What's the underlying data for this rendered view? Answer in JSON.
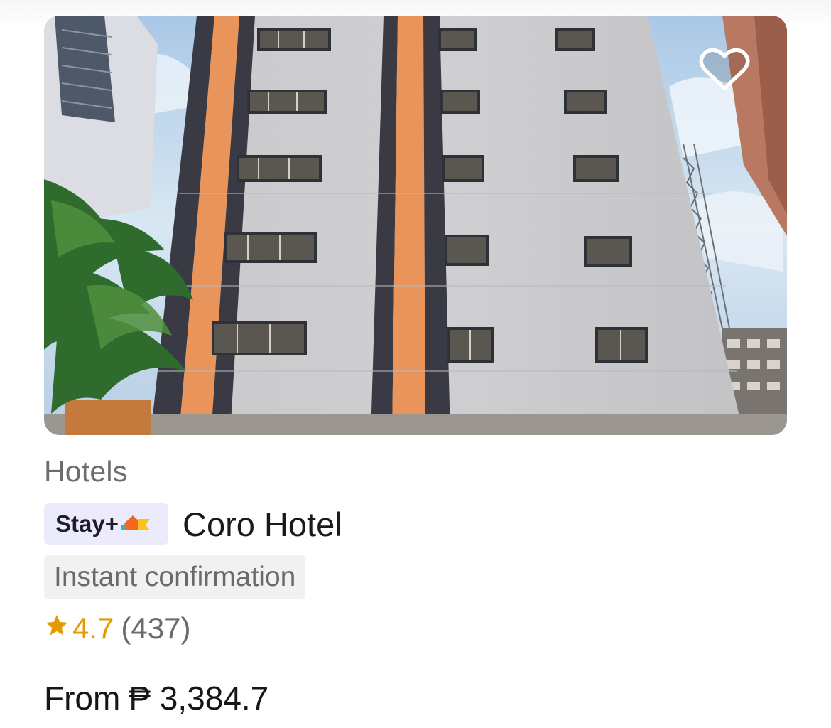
{
  "listing": {
    "category": "Hotels",
    "badge": {
      "label": "Stay+",
      "logo_icon": "stay-plus-house-icon",
      "colors": {
        "orange": "#f26a21",
        "yellow": "#ffc21a",
        "teal": "#2bbfb6",
        "bg": "#ecebfb"
      }
    },
    "hotel_name": "Coro Hotel",
    "tag": "Instant confirmation",
    "rating": {
      "icon": "star-icon",
      "score": "4.7",
      "count": "(437)"
    },
    "price": {
      "prefix": "From",
      "value": "₱ 3,384.7"
    },
    "favorite_icon": "heart-outline-icon"
  },
  "colors": {
    "rating_accent": "#e49a00",
    "muted_text": "#6d6d6d"
  }
}
